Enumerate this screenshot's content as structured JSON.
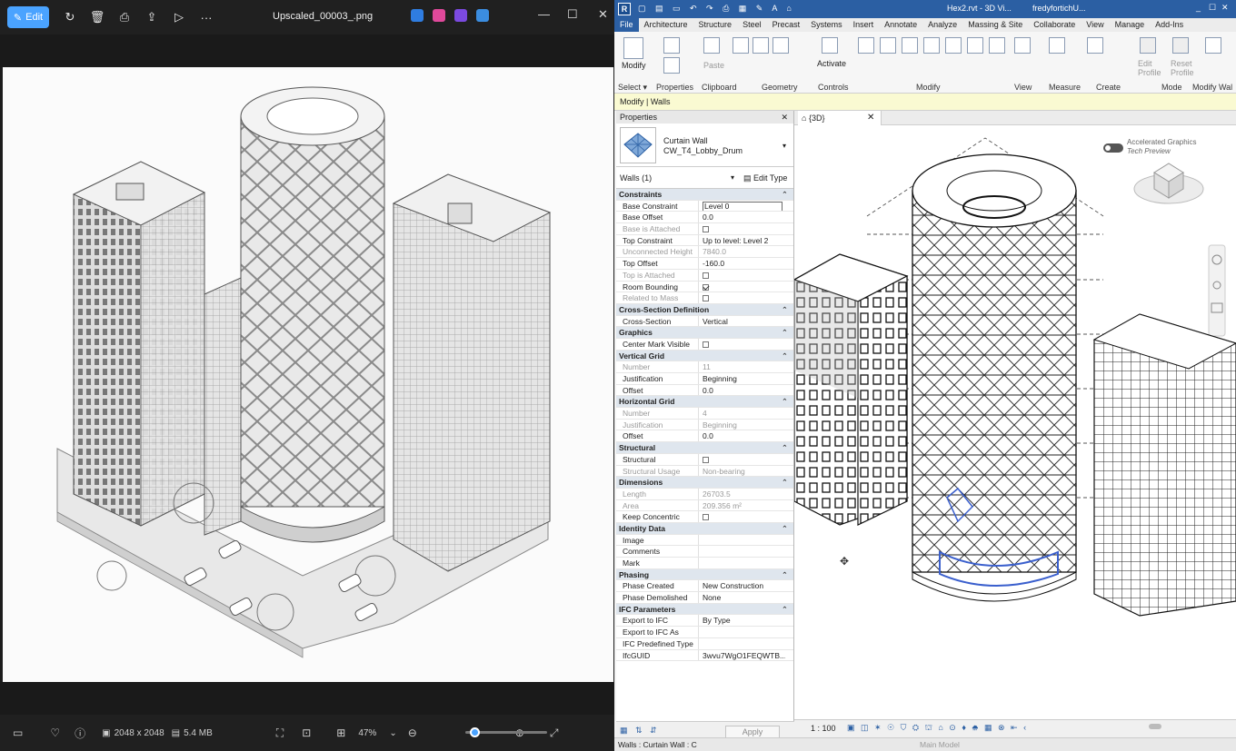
{
  "viewer": {
    "title": "Upscaled_00003_.png",
    "edit_label": "Edit",
    "more_label": "···",
    "dimensions": "2048 x 2048",
    "file_size": "5.4 MB",
    "zoom": "47%",
    "zoom_level": 0.05
  },
  "revit": {
    "qat_title": "Hex2.rvt - 3D Vi...",
    "user": "fredyfortichU...",
    "tabs": [
      "File",
      "Architecture",
      "Structure",
      "Steel",
      "Precast",
      "Systems",
      "Insert",
      "Annotate",
      "Analyze",
      "Massing & Site",
      "Collaborate",
      "View",
      "Manage",
      "Add-Ins"
    ],
    "ribbon": {
      "modify": "Modify",
      "activate": "Activate",
      "paste": "Paste",
      "edit_profile": "Edit Profile",
      "reset_profile": "Reset Profile",
      "groups": [
        "Select ▾",
        "Properties",
        "Clipboard",
        "Geometry",
        "Controls",
        "Modify",
        "View",
        "Measure",
        "Create",
        "Mode",
        "Modify Wal"
      ]
    },
    "context_label": "Modify | Walls",
    "properties": {
      "title": "Properties",
      "type_line1": "Curtain Wall",
      "type_line2": "CW_T4_Lobby_Drum",
      "filter": "Walls (1)",
      "edit_type": "Edit Type",
      "apply": "Apply",
      "rows": [
        {
          "kind": "sec",
          "k": "Constraints"
        },
        {
          "k": "Base Constraint",
          "v": "Level 0",
          "input": true
        },
        {
          "k": "Base Offset",
          "v": "0.0"
        },
        {
          "k": "Base is Attached",
          "v": "",
          "cb": "off",
          "dim": true
        },
        {
          "k": "Top Constraint",
          "v": "Up to level: Level 2"
        },
        {
          "k": "Unconnected Height",
          "v": "7840.0",
          "dim": true
        },
        {
          "k": "Top Offset",
          "v": "-160.0"
        },
        {
          "k": "Top is Attached",
          "v": "",
          "cb": "off",
          "dim": true
        },
        {
          "k": "Room Bounding",
          "v": "",
          "cb": "on"
        },
        {
          "k": "Related to Mass",
          "v": "",
          "cb": "off",
          "dim": true
        },
        {
          "kind": "sec",
          "k": "Cross-Section Definition"
        },
        {
          "k": "Cross-Section",
          "v": "Vertical"
        },
        {
          "kind": "sec",
          "k": "Graphics"
        },
        {
          "k": "Center Mark Visible",
          "v": "",
          "cb": "off"
        },
        {
          "kind": "sec",
          "k": "Vertical Grid"
        },
        {
          "k": "Number",
          "v": "11",
          "dim": true
        },
        {
          "k": "Justification",
          "v": "Beginning"
        },
        {
          "k": "Offset",
          "v": "0.0"
        },
        {
          "kind": "sec",
          "k": "Horizontal Grid"
        },
        {
          "k": "Number",
          "v": "4",
          "dim": true
        },
        {
          "k": "Justification",
          "v": "Beginning",
          "dim": true
        },
        {
          "k": "Offset",
          "v": "0.0"
        },
        {
          "kind": "sec",
          "k": "Structural"
        },
        {
          "k": "Structural",
          "v": "",
          "cb": "off"
        },
        {
          "k": "Structural Usage",
          "v": "Non-bearing",
          "dim": true
        },
        {
          "kind": "sec",
          "k": "Dimensions"
        },
        {
          "k": "Length",
          "v": "26703.5",
          "dim": true
        },
        {
          "k": "Area",
          "v": "209.356 m²",
          "dim": true
        },
        {
          "k": "Keep Concentric",
          "v": "",
          "cb": "off"
        },
        {
          "kind": "sec",
          "k": "Identity Data"
        },
        {
          "k": "Image",
          "v": ""
        },
        {
          "k": "Comments",
          "v": ""
        },
        {
          "k": "Mark",
          "v": ""
        },
        {
          "kind": "sec",
          "k": "Phasing"
        },
        {
          "k": "Phase Created",
          "v": "New Construction"
        },
        {
          "k": "Phase Demolished",
          "v": "None"
        },
        {
          "kind": "sec",
          "k": "IFC Parameters"
        },
        {
          "k": "Export to IFC",
          "v": "By Type"
        },
        {
          "k": "Export to IFC As",
          "v": ""
        },
        {
          "k": "IFC Predefined Type",
          "v": ""
        },
        {
          "k": "IfcGUID",
          "v": "3wvu7WgO1FEQWTB..."
        }
      ]
    },
    "view": {
      "tab": "{3D}",
      "accelerated": "Accelerated Graphics",
      "tech_preview": "Tech Preview",
      "scale": "1 : 100"
    },
    "status": "Walls : Curtain Wall : C",
    "main_model": "Main Model"
  },
  "colors": {
    "accent": "#4aa3ff",
    "revit_blue": "#2b5fa3",
    "selection": "#3a5fcd"
  }
}
